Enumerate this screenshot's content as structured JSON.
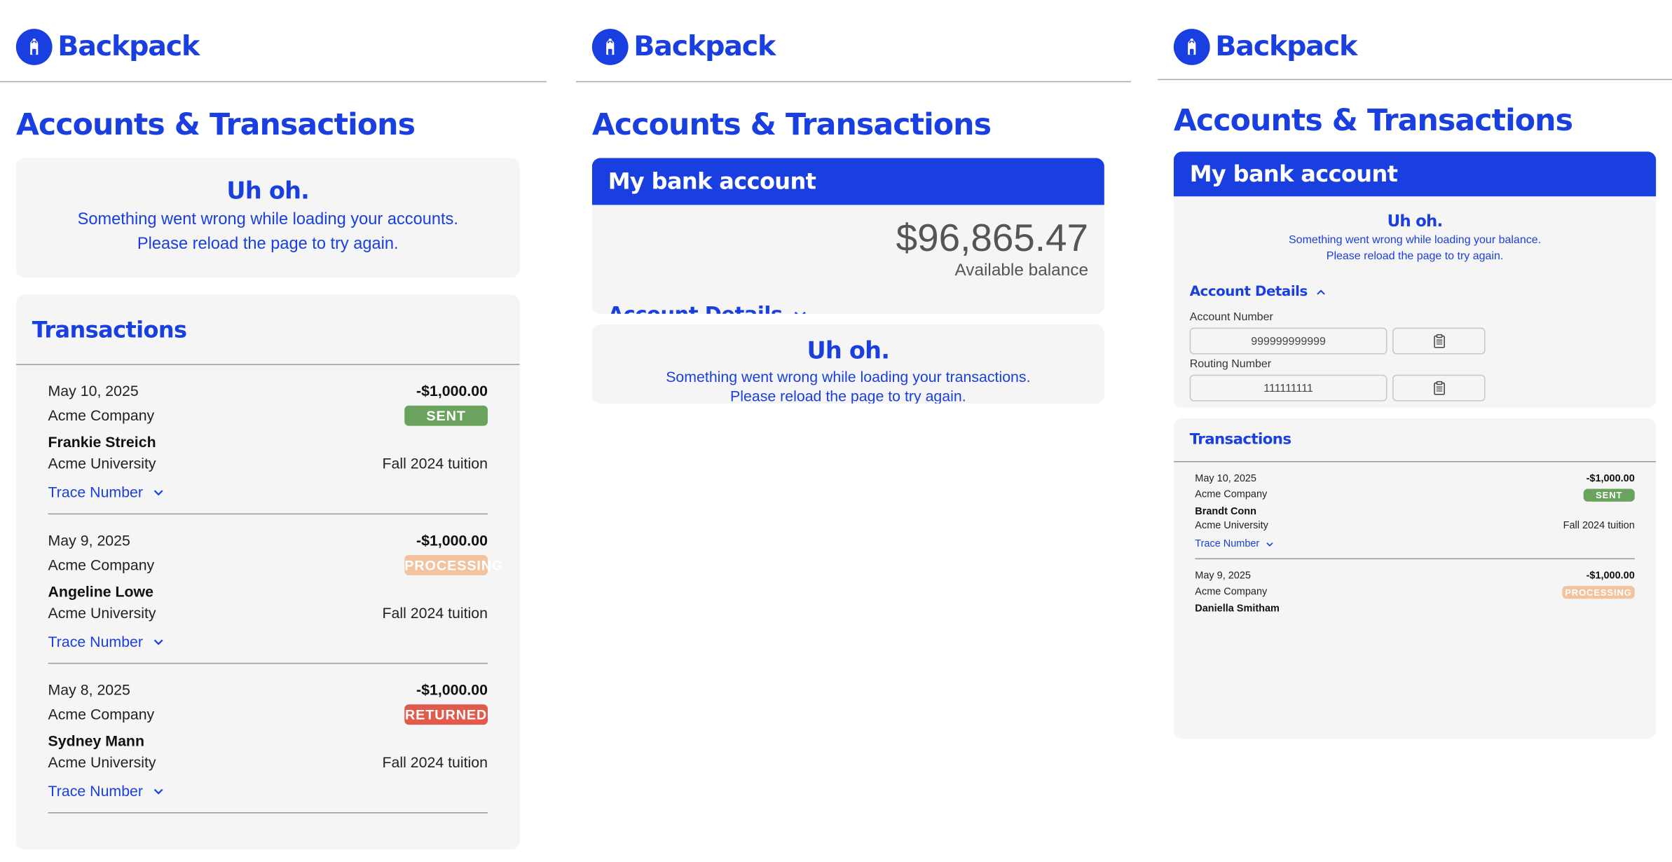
{
  "brand": {
    "name": "Backpack",
    "color": "#1a3fe0",
    "icon": "backpack-icon"
  },
  "page_title": "Accounts & Transactions",
  "panel1": {
    "accounts_error": {
      "title": "Uh oh.",
      "line1": "Something went wrong while loading your accounts.",
      "line2": "Please reload the page to try again."
    },
    "transactions_title": "Transactions",
    "transactions": [
      {
        "date": "May 10, 2025",
        "amount": "-$1,000.00",
        "company": "Acme Company",
        "status": "SENT",
        "name": "Frankie Streich",
        "school": "Acme University",
        "memo": "Fall 2024 tuition",
        "trace_label": "Trace Number"
      },
      {
        "date": "May 9, 2025",
        "amount": "-$1,000.00",
        "company": "Acme Company",
        "status": "PROCESSING",
        "name": "Angeline Lowe",
        "school": "Acme University",
        "memo": "Fall 2024 tuition",
        "trace_label": "Trace Number"
      },
      {
        "date": "May 8, 2025",
        "amount": "-$1,000.00",
        "company": "Acme Company",
        "status": "RETURNED",
        "name": "Sydney Mann",
        "school": "Acme University",
        "memo": "Fall 2024 tuition",
        "trace_label": "Trace Number"
      }
    ]
  },
  "panel2": {
    "account_title": "My bank account",
    "balance": "$96,865.47",
    "balance_label": "Available balance",
    "account_details_label": "Account Details",
    "transactions_error": {
      "title": "Uh oh.",
      "line1": "Something went wrong while loading your transactions.",
      "line2": "Please reload the page to try again."
    }
  },
  "panel3": {
    "account_title": "My bank account",
    "balance_error": {
      "title": "Uh oh.",
      "line1": "Something went wrong while loading your balance.",
      "line2": "Please reload the page to try again."
    },
    "account_details_label": "Account Details",
    "account_number_label": "Account Number",
    "account_number": "999999999999",
    "routing_number_label": "Routing Number",
    "routing_number": "111111111",
    "transactions_title": "Transactions",
    "transactions": [
      {
        "date": "May 10, 2025",
        "amount": "-$1,000.00",
        "company": "Acme Company",
        "status": "SENT",
        "name": "Brandt Conn",
        "school": "Acme University",
        "memo": "Fall 2024 tuition",
        "trace_label": "Trace Number"
      },
      {
        "date": "May 9, 2025",
        "amount": "-$1,000.00",
        "company": "Acme Company",
        "status": "PROCESSING",
        "name": "Daniella Smitham"
      }
    ]
  },
  "status_colors": {
    "SENT": "#6aa35d",
    "PROCESSING": "#f2c39e",
    "RETURNED": "#e15a4b"
  }
}
